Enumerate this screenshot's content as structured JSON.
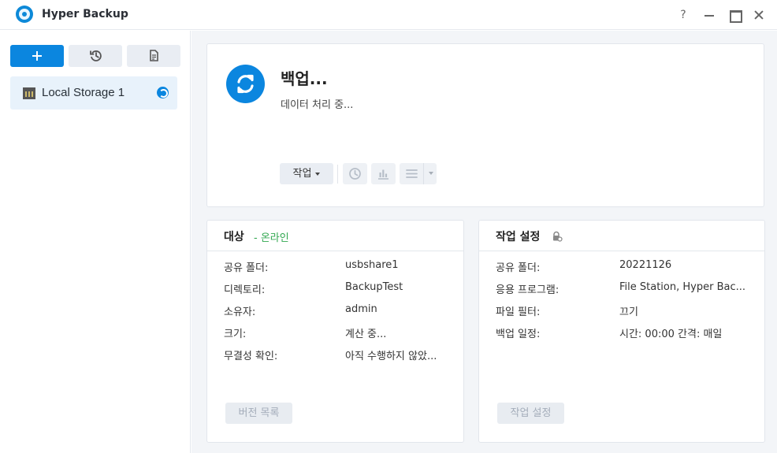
{
  "window": {
    "title": "Hyper Backup",
    "help": "?"
  },
  "sidebar": {
    "items": [
      {
        "label": "Local Storage 1"
      }
    ]
  },
  "status": {
    "title": "백업...",
    "description": "데이터 처리 중...",
    "action_button": "작업"
  },
  "target": {
    "title": "대상",
    "state": "- 온라인",
    "rows": [
      {
        "label": "공유 폴더:",
        "value": "usbshare1"
      },
      {
        "label": "디렉토리:",
        "value": "BackupTest"
      },
      {
        "label": "소유자:",
        "value": "admin"
      },
      {
        "label": "크기:",
        "value": "계산 중..."
      },
      {
        "label": "무결성 확인:",
        "value": "아직 수행하지 않았..."
      }
    ],
    "button": "버전 목록"
  },
  "task_settings": {
    "title": "작업 설정",
    "rows": [
      {
        "label": "공유 폴더:",
        "value": "20221126"
      },
      {
        "label": "응용 프로그램:",
        "value": "File Station, Hyper Bac..."
      },
      {
        "label": "파일 필터:",
        "value": "끄기"
      },
      {
        "label": "백업 일정:",
        "value": "시간: 00:00 간격: 매일"
      }
    ],
    "button": "작업 설정"
  }
}
